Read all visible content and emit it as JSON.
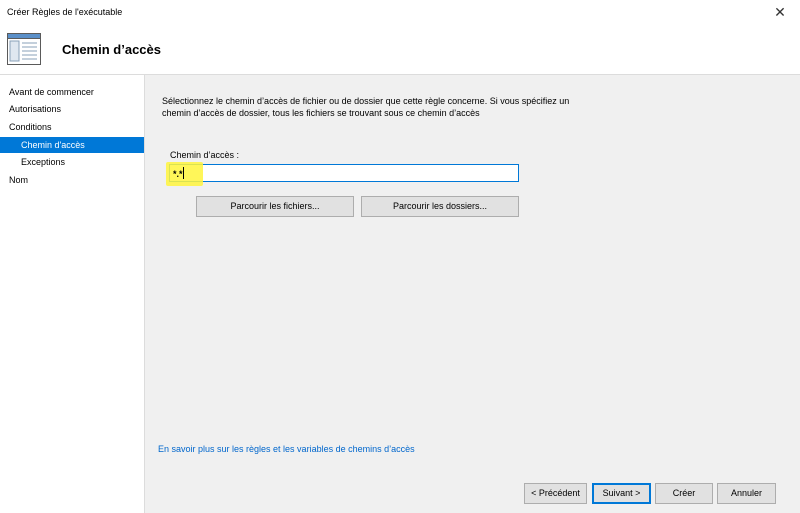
{
  "window": {
    "title": "Créer Règles de l'exécutable",
    "close_glyph": "✕"
  },
  "header": {
    "page_title": "Chemin d’accès",
    "icon": "wizard-page-icon"
  },
  "sidebar": {
    "items": [
      {
        "label": "Avant de commencer",
        "level": 0,
        "selected": false
      },
      {
        "label": "Autorisations",
        "level": 0,
        "selected": false
      },
      {
        "label": "Conditions",
        "level": 0,
        "selected": false
      },
      {
        "label": "Chemin d'accès",
        "level": 1,
        "selected": true
      },
      {
        "label": "Exceptions",
        "level": 1,
        "selected": false
      },
      {
        "label": "Nom",
        "level": 0,
        "selected": false
      }
    ]
  },
  "main": {
    "description": "Sélectionnez le chemin d’accès de fichier ou de dossier que cette règle concerne. Si vous spécifiez un chemin d’accès de dossier, tous les fichiers se trouvant sous ce chemin d’accès",
    "path_label": "Chemin d’accès :",
    "path_value": "*.*",
    "browse_files": "Parcourir les fichiers...",
    "browse_folders": "Parcourir les dossiers...",
    "learn_more": "En savoir plus sur les règles et les variables de chemins d’accès"
  },
  "footer": {
    "previous": "< Précédent",
    "next": "Suivant >",
    "create": "Créer",
    "cancel": "Annuler"
  },
  "colors": {
    "selection": "#0078d7",
    "highlight": "#fff53c",
    "link": "#0066cc",
    "panel_bg": "#f0f0f0"
  }
}
